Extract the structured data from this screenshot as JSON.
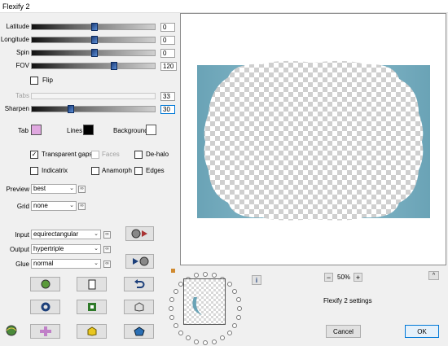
{
  "window": {
    "title": "Flexify 2"
  },
  "sliders": [
    {
      "label": "Latitude",
      "value": "0",
      "level": 0.5,
      "disabled": false
    },
    {
      "label": "Longitude",
      "value": "0",
      "level": 0.5,
      "disabled": false
    },
    {
      "label": "Spin",
      "value": "0",
      "level": 0.5,
      "disabled": false
    },
    {
      "label": "FOV",
      "value": "120",
      "level": 0.67,
      "disabled": false
    },
    {
      "label": "Tabs",
      "value": "33",
      "level": 0.33,
      "disabled": true
    },
    {
      "label": "Sharpen",
      "value": "30",
      "level": 0.3,
      "disabled": false
    }
  ],
  "flip_label": "Flip",
  "colors": {
    "tab_label": "Tab",
    "tab_color": "#e0a8e0",
    "lines_label": "Lines",
    "lines_color": "#000000",
    "background_label": "Background",
    "background_color": "#ffffff"
  },
  "options": {
    "transparent_gaps": "Transparent gaps",
    "faces": "Faces",
    "de_halo": "De-halo",
    "indicatrix": "Indicatrix",
    "anamorph": "Anamorph",
    "edges": "Edges"
  },
  "preview": {
    "label": "Preview",
    "value": "best"
  },
  "grid": {
    "label": "Grid",
    "value": "none"
  },
  "input": {
    "label": "Input",
    "value": "equirectangular"
  },
  "output": {
    "label": "Output",
    "value": "hypertriple"
  },
  "glue": {
    "label": "Glue",
    "value": "normal"
  },
  "zoom": {
    "minus": "−",
    "value": "50%",
    "plus": "+"
  },
  "info_icon": "i",
  "status_text": "Flexify 2 settings",
  "cancel_label": "Cancel",
  "ok_label": "OK",
  "accent": "#0078d7",
  "preview_frame_color": "#6aa3b6"
}
